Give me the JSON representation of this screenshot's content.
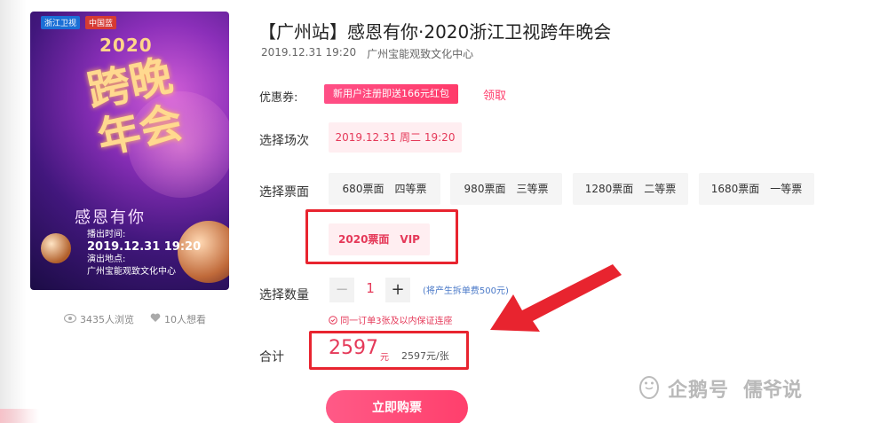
{
  "event": {
    "title": "【广州站】感恩有你·2020浙江卫视跨年晚会",
    "datetime": "2019.12.31 19:20",
    "venue": "广州宝能观致文化中心"
  },
  "poster": {
    "logo_zj": "浙江卫视",
    "logo_cn": "中国蓝",
    "year": "2020",
    "title_lines": [
      "跨",
      "晚",
      "年",
      "会"
    ],
    "subtitle": "感恩有你",
    "time_label": "播出时间:",
    "time_value": "2019.12.31 19:20",
    "place_label": "演出地点:",
    "place_value": "广州宝能观致文化中心",
    "views": "3435人浏览",
    "wants": "10人想看"
  },
  "coupon": {
    "label": "优惠券:",
    "badge": "新用户注册即送166元红包",
    "claim": "领取"
  },
  "session": {
    "label": "选择场次",
    "options": [
      "2019.12.31 周二 19:20"
    ]
  },
  "price": {
    "label": "选择票面",
    "options": [
      "680票面　四等票",
      "980票面　三等票",
      "1280票面　二等票",
      "1680票面　一等票",
      "2020票面　VIP"
    ],
    "selected_index": 4
  },
  "quantity": {
    "label": "选择数量",
    "minus": "−",
    "value": "1",
    "plus": "+",
    "note": "(将产生拆单费500元)",
    "guarantee": "同一订单3张及以内保证连座"
  },
  "total": {
    "label": "合计",
    "amount": "2597",
    "unit": "元",
    "per_ticket": "2597元/张"
  },
  "buy_button": "立即购票",
  "watermark": {
    "platform": "企鹅号",
    "author": "儒爷说"
  },
  "colors": {
    "accent": "#e53959",
    "annotation": "#e8242f"
  }
}
